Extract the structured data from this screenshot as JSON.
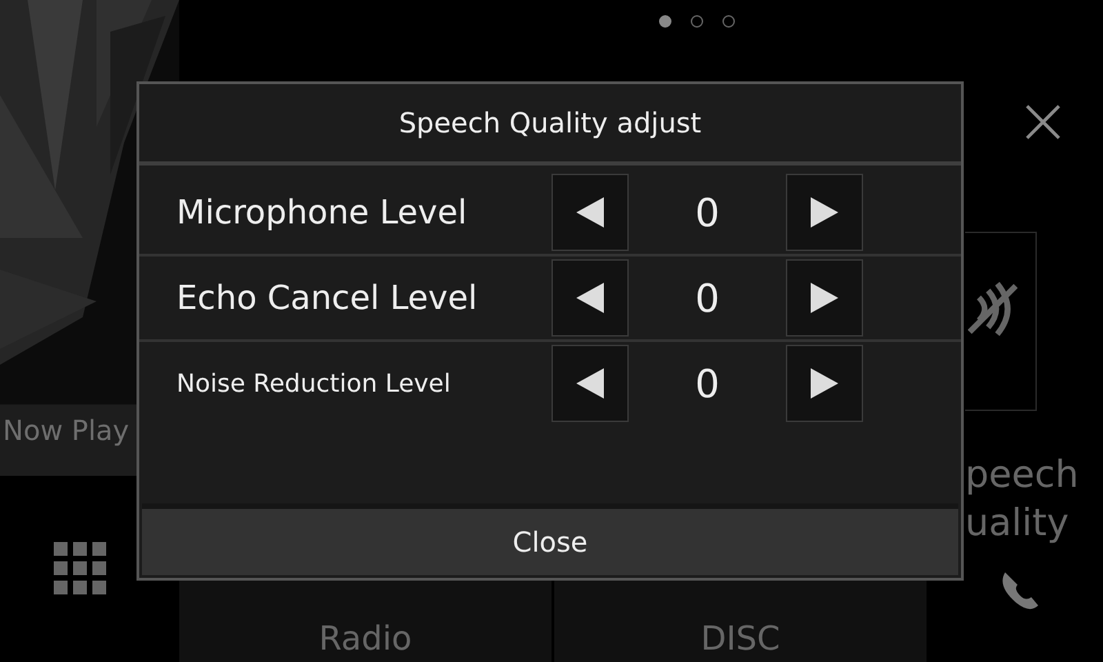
{
  "home": {
    "page_dots": [
      {
        "selected": true
      },
      {
        "selected": false
      },
      {
        "selected": false
      }
    ],
    "now_playing_label": "Now Play",
    "tiles": [
      "Radio",
      "DISC"
    ],
    "speech_quality_label": [
      "peech",
      "uality"
    ]
  },
  "dialog": {
    "title": "Speech Quality adjust",
    "rows": [
      {
        "label": "Microphone Level",
        "value": "0"
      },
      {
        "label": "Echo Cancel Level",
        "value": "0"
      },
      {
        "label": "Noise Reduction Level",
        "value": "0"
      }
    ],
    "close_button": "Close"
  }
}
